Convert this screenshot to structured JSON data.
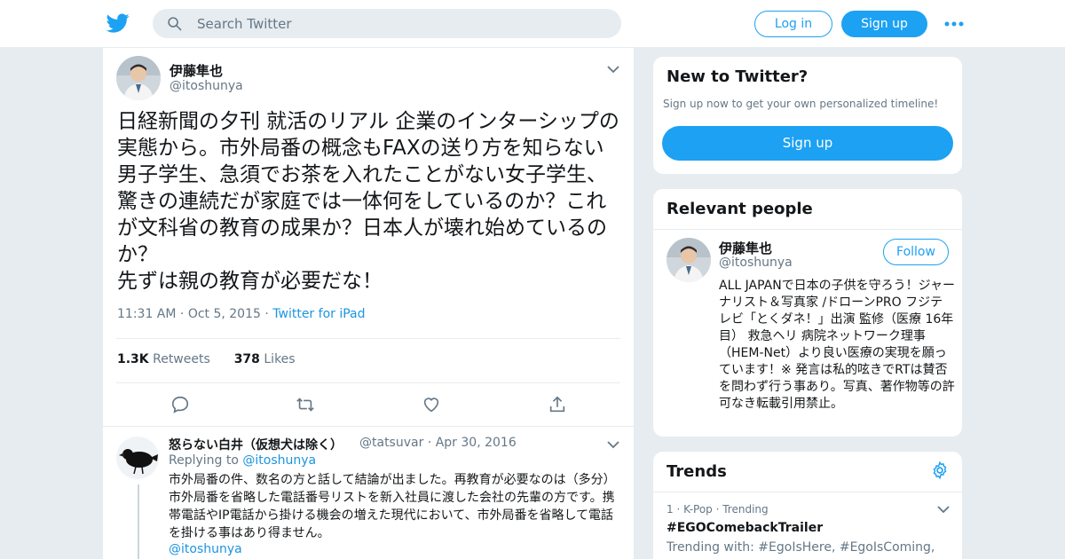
{
  "header": {
    "search_placeholder": "Search Twitter",
    "login_label": "Log in",
    "signup_label": "Sign up",
    "brand_color": "#1da1f2"
  },
  "tweet": {
    "author_name": "伊藤隼也",
    "author_handle": "@itoshunya",
    "text": "日経新聞の夕刊 就活のリアル 企業のインターシップの実態から。市外局番の概念もFAXの送り方を知らない男子学生、急須でお茶を入れたことがない女子学生、驚きの連続だが家庭では一体何をしているのか？これが文科省の教育の成果か？日本人が壊れ始めているのか？\n先ずは親の教育が必要だな！",
    "time": "11:31 AM",
    "date": "Oct 5, 2015",
    "source": "Twitter for iPad",
    "retweets_count": "1.3K",
    "retweets_label": "Retweets",
    "likes_count": "378",
    "likes_label": "Likes"
  },
  "reply": {
    "author_name": "怒らない白井（仮想犬は除く）",
    "author_handle": "@tatsuvar",
    "date": "Apr 30, 2016",
    "replying_to_label": "Replying to",
    "replying_to_handle": "@itoshunya",
    "text": "市外局番の件、数名の方と話して結論が出ました。再教育が必要なのは（多分）市外局番を省略した電話番号リストを新入社員に渡した会社の先輩の方です。携帯電話やIP電話から掛ける機会の増えた現代において、市外局番を省略して電話を掛ける事はあり得ません。",
    "mention": "@itoshunya"
  },
  "new_to_twitter": {
    "title": "New to Twitter?",
    "subtitle": "Sign up now to get your own personalized timeline!",
    "button_label": "Sign up"
  },
  "relevant_people": {
    "title": "Relevant people",
    "name": "伊藤隼也",
    "handle": "@itoshunya",
    "follow_label": "Follow",
    "bio": "ALL JAPANで日本の子供を守ろう！ジャーナリスト＆写真家 /ドローンPRO フジテレビ「とくダネ！」出演 監修（医療 16年目） 救急ヘリ 病院ネットワーク理事（HEM-Net）より良い医療の実現を願っています！※ 発言は私的呟きでRTは賛否を問わず行う事あり。写真、著作物等の許可なき転載引用禁止。"
  },
  "trends": {
    "title": "Trends",
    "items": [
      {
        "meta": "1 · K-Pop · Trending",
        "tag": "#EGOComebackTrailer",
        "with": "Trending with: #EgoIsHere, #EgoIsComing,"
      }
    ]
  }
}
